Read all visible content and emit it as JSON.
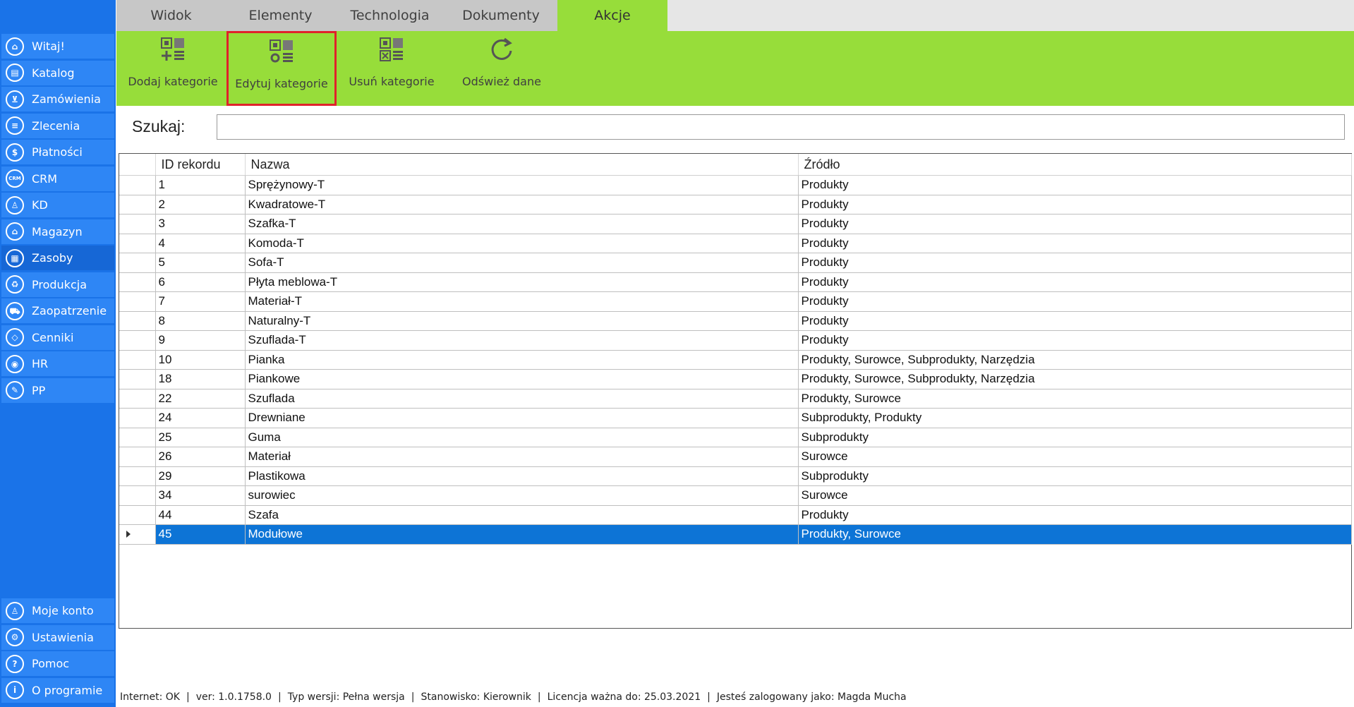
{
  "sidebar": {
    "items": [
      {
        "label": "Witaj!",
        "icon": "home-icon",
        "glyph": "⌂"
      },
      {
        "label": "Katalog",
        "icon": "book-icon",
        "glyph": "▤"
      },
      {
        "label": "Zamówienia",
        "icon": "cart-icon",
        "glyph": "⊻"
      },
      {
        "label": "Zlecenia",
        "icon": "list-icon",
        "glyph": "≡"
      },
      {
        "label": "Płatności",
        "icon": "dollar-icon",
        "glyph": "$"
      },
      {
        "label": "CRM",
        "icon": "crm-icon",
        "glyph": "CRM"
      },
      {
        "label": "KD",
        "icon": "person-icon",
        "glyph": "♙"
      },
      {
        "label": "Magazyn",
        "icon": "warehouse-icon",
        "glyph": "⌂"
      },
      {
        "label": "Zasoby",
        "icon": "resources-icon",
        "glyph": "▦"
      },
      {
        "label": "Produkcja",
        "icon": "production-icon",
        "glyph": "♻"
      },
      {
        "label": "Zaopatrzenie",
        "icon": "truck-icon",
        "glyph": "⛟"
      },
      {
        "label": "Cenniki",
        "icon": "tag-icon",
        "glyph": "◇"
      },
      {
        "label": "HR",
        "icon": "hr-icon",
        "glyph": "◉"
      },
      {
        "label": "PP",
        "icon": "pp-icon",
        "glyph": "✎"
      }
    ],
    "bottom_items": [
      {
        "label": "Moje konto",
        "icon": "account-icon",
        "glyph": "♙"
      },
      {
        "label": "Ustawienia",
        "icon": "settings-icon",
        "glyph": "⚙"
      },
      {
        "label": "Pomoc",
        "icon": "help-icon",
        "glyph": "?"
      },
      {
        "label": "O programie",
        "icon": "info-icon",
        "glyph": "i"
      }
    ],
    "active": "Zasoby"
  },
  "tabs": [
    "Widok",
    "Elementy",
    "Technologia",
    "Dokumenty",
    "Akcje"
  ],
  "active_tab": "Akcje",
  "ribbon": {
    "add_label": "Dodaj kategorie",
    "edit_label": "Edytuj kategorie",
    "delete_label": "Usuń kategorie",
    "refresh_label": "Odśwież dane"
  },
  "search": {
    "label": "Szukaj:",
    "value": ""
  },
  "grid": {
    "columns": [
      "ID rekordu",
      "Nazwa",
      "Źródło"
    ],
    "rows": [
      {
        "id": "1",
        "name": "Sprężynowy-T",
        "source": "Produkty"
      },
      {
        "id": "2",
        "name": "Kwadratowe-T",
        "source": "Produkty"
      },
      {
        "id": "3",
        "name": "Szafka-T",
        "source": "Produkty"
      },
      {
        "id": "4",
        "name": "Komoda-T",
        "source": "Produkty"
      },
      {
        "id": "5",
        "name": "Sofa-T",
        "source": "Produkty"
      },
      {
        "id": "6",
        "name": "Płyta meblowa-T",
        "source": "Produkty"
      },
      {
        "id": "7",
        "name": "Materiał-T",
        "source": "Produkty"
      },
      {
        "id": "8",
        "name": "Naturalny-T",
        "source": "Produkty"
      },
      {
        "id": "9",
        "name": "Szuflada-T",
        "source": "Produkty"
      },
      {
        "id": "10",
        "name": "Pianka",
        "source": "Produkty, Surowce, Subprodukty, Narzędzia"
      },
      {
        "id": "18",
        "name": "Piankowe",
        "source": "Produkty, Surowce, Subprodukty, Narzędzia"
      },
      {
        "id": "22",
        "name": "Szuflada",
        "source": "Produkty, Surowce"
      },
      {
        "id": "24",
        "name": "Drewniane",
        "source": "Subprodukty, Produkty"
      },
      {
        "id": "25",
        "name": "Guma",
        "source": "Subprodukty"
      },
      {
        "id": "26",
        "name": "Materiał",
        "source": "Surowce"
      },
      {
        "id": "29",
        "name": "Plastikowa",
        "source": "Subprodukty"
      },
      {
        "id": "34",
        "name": "surowiec",
        "source": "Surowce"
      },
      {
        "id": "44",
        "name": "Szafa",
        "source": "Produkty"
      },
      {
        "id": "45",
        "name": "Modułowe",
        "source": "Produkty, Surowce"
      }
    ],
    "selected_id": "45"
  },
  "status": {
    "internet": "Internet: OK",
    "version": "ver: 1.0.1758.0",
    "edition": "Typ wersji: Pełna wersja",
    "position": "Stanowisko: Kierownik",
    "license": "Licencja ważna do: 25.03.2021",
    "user": "Jesteś zalogowany jako: Magda Mucha"
  },
  "colors": {
    "sidebar_bg": "#1a73e8",
    "sidebar_item": "#2e86f5",
    "ribbon_bg": "#97dd3a",
    "selection": "#0d74d6",
    "highlight_border": "#e0222b"
  }
}
